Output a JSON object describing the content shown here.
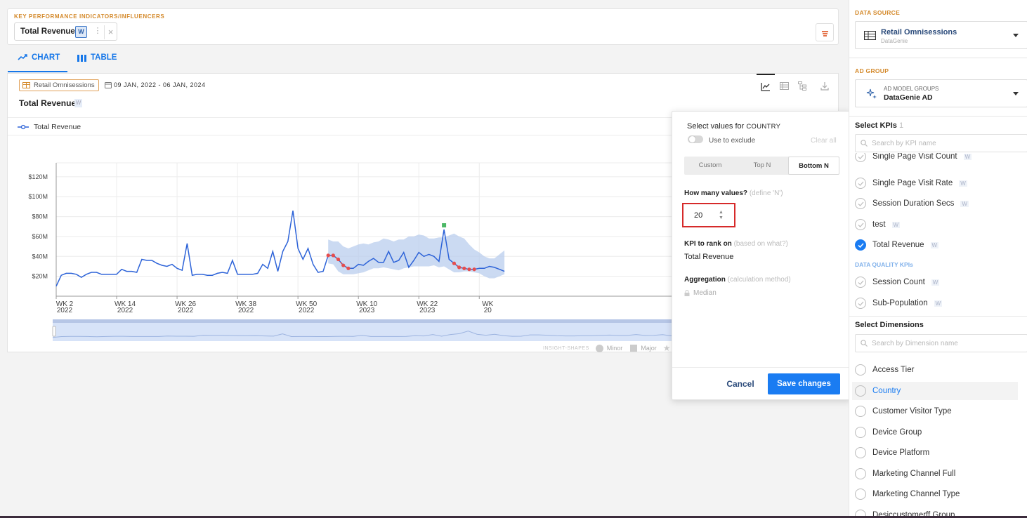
{
  "kpi_bar": {
    "heading": "KEY PERFORMANCE INDICATORS/INFLUENCERS",
    "chip_label": "Total Revenue",
    "chip_badge": "W",
    "chip_more": "⋮",
    "chip_close": "×"
  },
  "tabs": [
    {
      "label": "CHART",
      "icon": "trend-line-icon",
      "active": true
    },
    {
      "label": "TABLE",
      "icon": "bar-columns-icon",
      "active": false
    }
  ],
  "card": {
    "source_tag": "Retail Omnisessions",
    "date_range": "09 JAN, 2022 - 06 JAN, 2024",
    "title": "Total Revenue",
    "title_badge": "W",
    "legend_label": "Total Revenue",
    "insight_legend": {
      "label": "INSIGHT-SHAPES",
      "minor": "Minor",
      "major": "Major"
    }
  },
  "chart_data": {
    "type": "line",
    "series": [
      {
        "name": "Total Revenue",
        "color": "#2d63d8"
      }
    ],
    "y_ticks": [
      "$20M",
      "$40M",
      "$60M",
      "$80M",
      "$100M",
      "$120M"
    ],
    "ylim": [
      0,
      134
    ],
    "x_ticks": [
      {
        "week": "WK 2",
        "year": "2022"
      },
      {
        "week": "WK 14",
        "year": "2022"
      },
      {
        "week": "WK 26",
        "year": "2022"
      },
      {
        "week": "WK 38",
        "year": "2022"
      },
      {
        "week": "WK 50",
        "year": "2022"
      },
      {
        "week": "WK 10",
        "year": "2023"
      },
      {
        "week": "WK 22",
        "year": "2023"
      },
      {
        "week": "WK",
        "year": "20"
      }
    ],
    "values": [
      10,
      21,
      23,
      23,
      22,
      19,
      22,
      24,
      24,
      22,
      22,
      22,
      22,
      27,
      25,
      25,
      24,
      37,
      36,
      36,
      33,
      31,
      30,
      32,
      28,
      26,
      53,
      21,
      22,
      22,
      21,
      21,
      23,
      24,
      23,
      36,
      22,
      22,
      22,
      22,
      23,
      32,
      28,
      45,
      25,
      45,
      55,
      86,
      48,
      37,
      48,
      32,
      24,
      25,
      41,
      41,
      37,
      31,
      28,
      28,
      32,
      31,
      35,
      38,
      34,
      34,
      45,
      34,
      36,
      44,
      29,
      36,
      44,
      40,
      42,
      40,
      35,
      67,
      37,
      33,
      29,
      28,
      27,
      27,
      28,
      28,
      30,
      29,
      27,
      25
    ],
    "band_start": 54,
    "band_upper": [
      57,
      55,
      55,
      50,
      48,
      50,
      52,
      53,
      52,
      54,
      55,
      58,
      57,
      55,
      57,
      57,
      60,
      60,
      62,
      61,
      58,
      58,
      59,
      59,
      61,
      63,
      60,
      58,
      52,
      47,
      44,
      40,
      38,
      38,
      42,
      46
    ],
    "band_lower": [
      33,
      32,
      25,
      22,
      22,
      22,
      23,
      24,
      26,
      28,
      28,
      29,
      28,
      27,
      26,
      28,
      29,
      30,
      30,
      30,
      30,
      31,
      29,
      30,
      27,
      24,
      24,
      25,
      25,
      24,
      23,
      20,
      18,
      18,
      20,
      22
    ],
    "anomaly_minor_indices": [
      54,
      55,
      56,
      57,
      58,
      79,
      80,
      81,
      82,
      83
    ],
    "anomaly_major_indices": [
      77
    ]
  },
  "popover": {
    "title": "Select values for",
    "title_dim": "COUNTRY",
    "toggle_label": "Use to exclude",
    "clear_all": "Clear all",
    "segments": [
      "Custom",
      "Top N",
      "Bottom N"
    ],
    "active_segment": "Bottom N",
    "how_many_label": "How many values?",
    "how_many_hint": "(define 'N')",
    "n_value": "20",
    "rank_label": "KPI to rank on",
    "rank_hint": "(based on what?)",
    "rank_value": "Total Revenue",
    "agg_label": "Aggregation",
    "agg_hint": "(calculation method)",
    "agg_value": "Median",
    "cancel": "Cancel",
    "save": "Save changes"
  },
  "right_panel": {
    "data_source_heading": "DATA SOURCE",
    "data_source_name": "Retail Omnisessions",
    "data_source_sub": "DataGenie",
    "ad_group_heading": "AD GROUP",
    "ad_group_sub": "AD MODEL GROUPS",
    "ad_group_name": "DataGenie AD",
    "kpis_title": "Select KPIs",
    "kpis_count": "1",
    "kpi_search_placeholder": "Search by KPI name",
    "kpis": [
      {
        "label": "Single Page Visit Count",
        "badge": "W",
        "checked": false
      },
      {
        "label": "Single Page Visit Rate",
        "badge": "W",
        "checked": false
      },
      {
        "label": "Session Duration Secs",
        "badge": "W",
        "checked": false
      },
      {
        "label": "test",
        "badge": "W",
        "checked": false
      },
      {
        "label": "Total Revenue",
        "badge": "W",
        "checked": true
      }
    ],
    "dq_heading": "DATA QUALITY KPIs",
    "dq_kpis": [
      {
        "label": "Session Count",
        "badge": "W"
      },
      {
        "label": "Sub-Population",
        "badge": "W"
      }
    ],
    "dims_title": "Select Dimensions",
    "dim_search_placeholder": "Search by Dimension name",
    "dims": [
      {
        "label": "Access Tier",
        "active": false
      },
      {
        "label": "Country",
        "active": true
      },
      {
        "label": "Customer Visitor Type",
        "active": false
      },
      {
        "label": "Device Group",
        "active": false
      },
      {
        "label": "Device Platform",
        "active": false
      },
      {
        "label": "Marketing Channel Full",
        "active": false
      },
      {
        "label": "Marketing Channel Type",
        "active": false
      },
      {
        "label": "Desiccustomerff Group",
        "active": false
      }
    ]
  }
}
